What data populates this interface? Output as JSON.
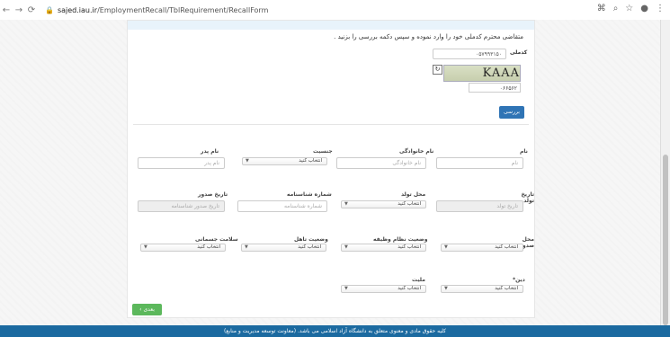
{
  "browser": {
    "url_host": "sajed.iau.ir",
    "url_path": "/EmploymentRecall/TblRequirement/RecallForm"
  },
  "form": {
    "intro": "متقاضی محترم کدملی خود را وارد نموده و سپس دکمه بررسی را بزنید .",
    "code_label": "کدملی",
    "code_value": "۰۵۷۹۹۳۱۵۰",
    "captcha_text": "KAAA",
    "captcha_input": "۰۶۶۵۶۲",
    "check_button": "بررسی",
    "fields": {
      "name": {
        "label": "نام",
        "placeholder": "نام"
      },
      "family": {
        "label": "نام خانوادگی",
        "placeholder": "نام خانوادگی"
      },
      "gender": {
        "label": "جنسیت",
        "value": "انتخاب کنید"
      },
      "father": {
        "label": "نام پدر",
        "placeholder": "نام پدر"
      },
      "birth_date": {
        "label": "تاریخ تولد",
        "placeholder": "تاریخ تولد"
      },
      "birth_place": {
        "label": "محل تولد",
        "value": "انتخاب کنید"
      },
      "id_number": {
        "label": "شماره شناسنامه",
        "placeholder": "شماره شناسنامه"
      },
      "issue_date": {
        "label": "تاریخ صدور",
        "placeholder": "تاریخ صدور شناسنامه"
      },
      "issue_place": {
        "label": "محل صدور",
        "value": "انتخاب کنید"
      },
      "military": {
        "label": "وضعیت نظام وظیفه",
        "value": "انتخاب کنید"
      },
      "marital": {
        "label": "وضعیت تاهل",
        "value": "انتخاب کنید"
      },
      "health": {
        "label": "سلامت جسمانی",
        "value": "انتخاب کنید"
      },
      "religion": {
        "label": "دین*",
        "value": "انتخاب کنید"
      },
      "nationality": {
        "label": "ملیت",
        "value": "انتخاب کنید"
      }
    },
    "next_button": "بعدی ›"
  },
  "footer": "کلیه حقوق مادی و معنوی متعلق به دانشگاه آزاد اسلامی می باشد. (معاونت توسعه مدیریت و منابع)"
}
